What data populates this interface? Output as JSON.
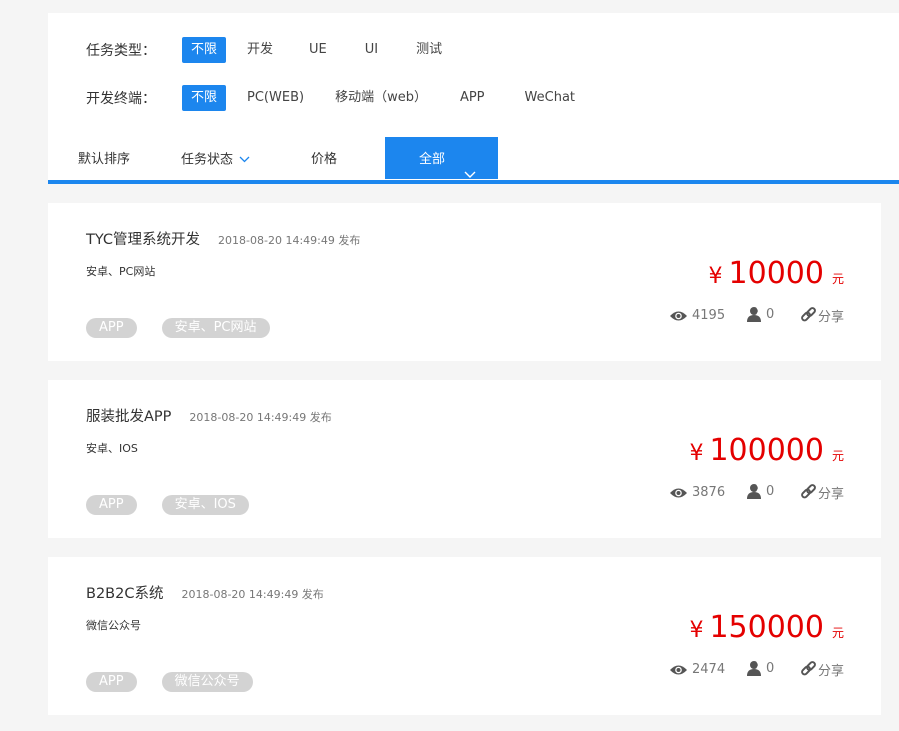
{
  "filters": {
    "task_type": {
      "label": "任务类型：",
      "options": [
        "不限",
        "开发",
        "UE",
        "UI",
        "测试"
      ],
      "active": "不限"
    },
    "platform": {
      "label": "开发终端：",
      "options": [
        "不限",
        "PC(WEB)",
        "移动端（web）",
        "APP",
        "WeChat"
      ],
      "active": "不限"
    }
  },
  "sort": {
    "default_label": "默认排序",
    "status_label": "任务状态",
    "price_label": "价格",
    "all_label": "全部"
  },
  "colors": {
    "accent": "#1c86ee",
    "price": "#e40000",
    "tag_bg": "#d3d3d3"
  },
  "listings": [
    {
      "title": "TYC管理系统开发",
      "date": "2018-08-20 14:49:49 发布",
      "subtitle": "安卓、PC网站",
      "currency": "¥",
      "price": "10000",
      "unit": "元",
      "tags": [
        "APP",
        "安卓、PC网站"
      ],
      "views": "4195",
      "bidders": "0",
      "share_label": "分享"
    },
    {
      "title": "服装批发APP",
      "date": "2018-08-20 14:49:49 发布",
      "subtitle": "安卓、IOS",
      "currency": "¥",
      "price": "100000",
      "unit": "元",
      "tags": [
        "APP",
        "安卓、IOS"
      ],
      "views": "3876",
      "bidders": "0",
      "share_label": "分享"
    },
    {
      "title": "B2B2C系统",
      "date": "2018-08-20 14:49:49 发布",
      "subtitle": "微信公众号",
      "currency": "¥",
      "price": "150000",
      "unit": "元",
      "tags": [
        "APP",
        "微信公众号"
      ],
      "views": "2474",
      "bidders": "0",
      "share_label": "分享"
    }
  ]
}
